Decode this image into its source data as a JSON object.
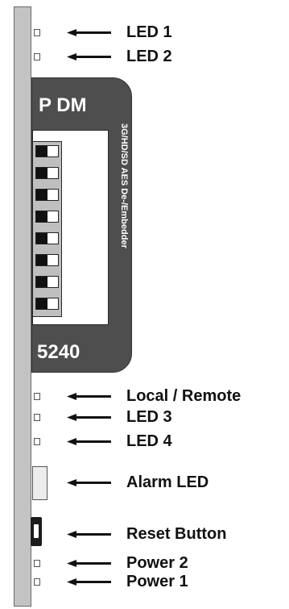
{
  "module": {
    "brand": "P DM",
    "number": "5240",
    "description": "3G/HD/SD AES De-/Embedder"
  },
  "dip_switches": [
    {
      "position": "off"
    },
    {
      "position": "off"
    },
    {
      "position": "off"
    },
    {
      "position": "off"
    },
    {
      "position": "off"
    },
    {
      "position": "off"
    },
    {
      "position": "off"
    },
    {
      "position": "off"
    }
  ],
  "callouts": {
    "led1": "LED 1",
    "led2": "LED 2",
    "local_remote": "Local / Remote",
    "led3": "LED 3",
    "led4": "LED 4",
    "alarm": "Alarm LED",
    "reset": "Reset Button",
    "power2": "Power 2",
    "power1": "Power 1"
  }
}
